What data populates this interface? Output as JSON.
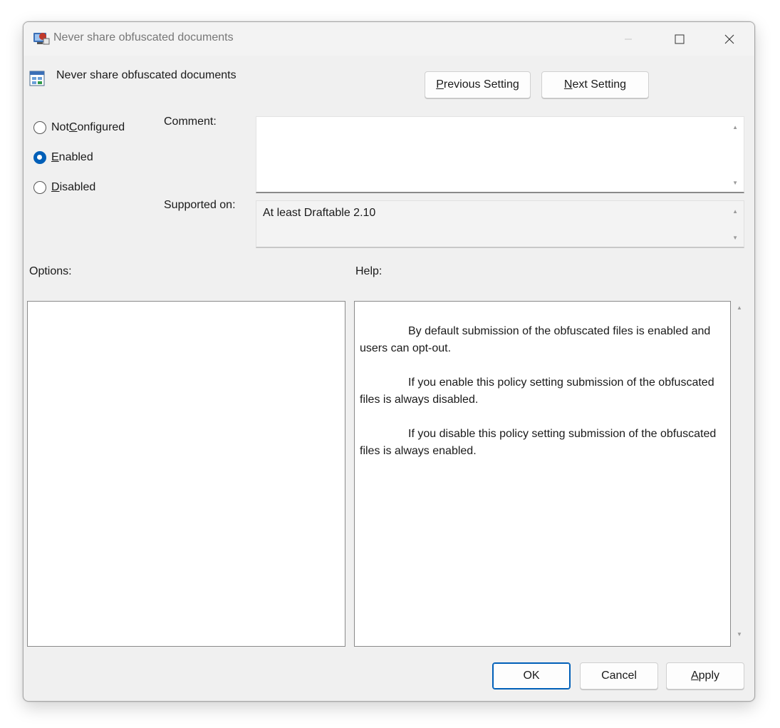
{
  "window": {
    "title": "Never share obfuscated documents"
  },
  "policy": {
    "name": "Never share obfuscated documents"
  },
  "nav": {
    "previous_label_prefix": "",
    "previous_label_u": "P",
    "previous_label_rest": "revious Setting",
    "next_label_u": "N",
    "next_label_rest": "ext Setting"
  },
  "state": {
    "options": [
      {
        "pre": "Not ",
        "u": "C",
        "post": "onfigured",
        "checked": false
      },
      {
        "pre": "",
        "u": "E",
        "post": "nabled",
        "checked": true
      },
      {
        "pre": "",
        "u": "D",
        "post": "isabled",
        "checked": false
      }
    ]
  },
  "labels": {
    "comment": "Comment:",
    "supported_on": "Supported on:",
    "options": "Options:",
    "help": "Help:"
  },
  "comment": {
    "value": ""
  },
  "supported_on": {
    "value": "At least Draftable 2.10"
  },
  "help": {
    "paragraphs": [
      "By default submission of the obfuscated files is enabled and users can opt-out.",
      "If you enable this policy setting submission of the obfuscated files is always disabled.",
      "If you disable this policy setting submission of the obfuscated files is always enabled."
    ]
  },
  "footer": {
    "ok": "OK",
    "cancel": "Cancel",
    "apply_u": "A",
    "apply_rest": "pply"
  },
  "colors": {
    "accent": "#005fb8",
    "window_bg": "#f0f0f0"
  }
}
